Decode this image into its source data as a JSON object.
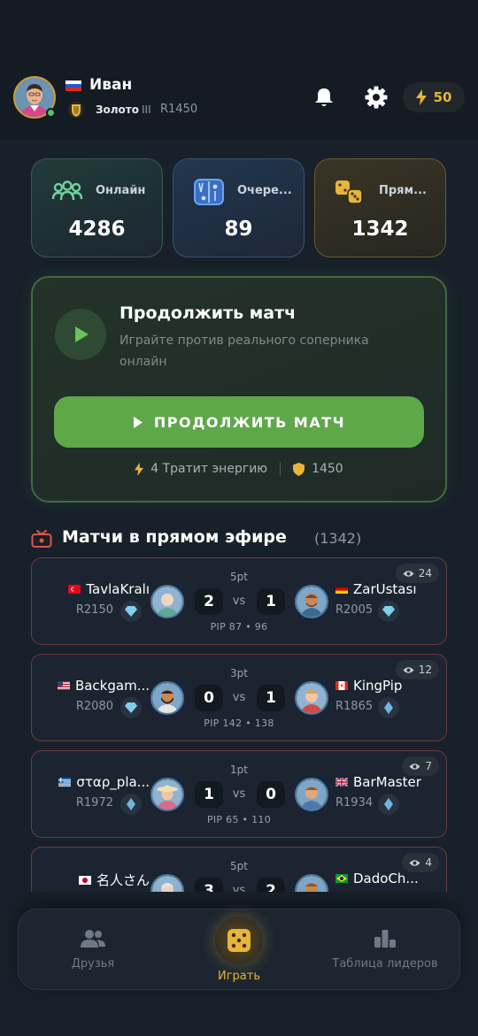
{
  "header": {
    "user_name": "Иван",
    "flag": "ru",
    "rank_name": "Золото",
    "rank_tier": "III",
    "rating": "R1450",
    "energy": "50",
    "icons": [
      "avatar",
      "bell-icon",
      "gear-icon",
      "lightning-icon"
    ]
  },
  "stats": [
    {
      "label": "Онлайн",
      "value": "4286",
      "icon": "users-icon",
      "color": "#6fd39a"
    },
    {
      "label": "Очере...",
      "value": "89",
      "icon": "board-icon",
      "color": "#5a9cf0"
    },
    {
      "label": "Прям...",
      "value": "1342",
      "icon": "dice-icon",
      "color": "#e7b53a"
    }
  ],
  "continue": {
    "title": "Продолжить матч",
    "subtitle": "Играйте против реального соперника онлайн",
    "button_label": "ПРОДОЛЖИТЬ МАТЧ",
    "energy_cost": "4 Тратит энергию",
    "rating_value": "1450"
  },
  "live": {
    "title": "Матчи в прямом эфире",
    "count": "(1342)",
    "matches": [
      {
        "pt": "5pt",
        "viewers": "24",
        "left_flag": "tr",
        "left_name": "TavlaKralı",
        "left_rating": "R2150",
        "left_score": "2",
        "right_flag": "de",
        "right_name": "ZarUstası",
        "right_rating": "R2005",
        "right_score": "1",
        "vs": "vs",
        "pip": "PIP 87 • 96"
      },
      {
        "pt": "3pt",
        "viewers": "12",
        "left_flag": "us",
        "left_name": "Backgam...",
        "left_rating": "R2080",
        "left_score": "0",
        "right_flag": "ca",
        "right_name": "KingPip",
        "right_rating": "R1865",
        "right_score": "1",
        "vs": "vs",
        "pip": "PIP 142 • 138"
      },
      {
        "pt": "1pt",
        "viewers": "7",
        "left_flag": "gr",
        "left_name": "σταρ_pla...",
        "left_rating": "R1972",
        "left_score": "1",
        "right_flag": "gb",
        "right_name": "BarMaster",
        "right_rating": "R1934",
        "right_score": "0",
        "vs": "vs",
        "pip": "PIP 65 • 110"
      },
      {
        "pt": "5pt",
        "viewers": "4",
        "left_flag": "jp",
        "left_name": "名人さん",
        "left_rating": "",
        "left_score": "3",
        "right_flag": "br",
        "right_name": "DadoCh...",
        "right_rating": "",
        "right_score": "2",
        "vs": "vs",
        "pip": ""
      }
    ]
  },
  "nav": {
    "friends": "Друзья",
    "play": "Играть",
    "leaders": "Таблица лидеров"
  }
}
